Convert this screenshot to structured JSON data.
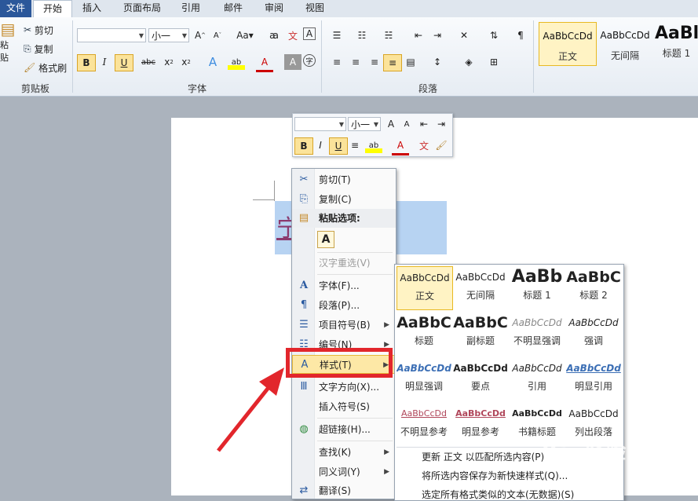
{
  "ribbon": {
    "tabs": [
      "文件",
      "开始",
      "插入",
      "页面布局",
      "引用",
      "邮件",
      "审阅",
      "视图"
    ],
    "clipboard": {
      "paste": "粘贴",
      "cut": "剪切",
      "copy": "复制",
      "format_painter": "格式刷",
      "group": "剪贴板"
    },
    "font": {
      "font_name": "",
      "font_size": "小一",
      "group": "字体"
    },
    "paragraph": {
      "group": "段落"
    },
    "styles": [
      {
        "preview": "AaBbCcDd",
        "name": "正文"
      },
      {
        "preview": "AaBbCcDd",
        "name": "无间隔"
      },
      {
        "preview": "AaBl",
        "name": "标题 1"
      }
    ]
  },
  "document": {
    "selected_text": "宁313"
  },
  "mini_toolbar": {
    "font_size": "小一"
  },
  "context_menu": {
    "items": [
      {
        "label": "剪切(T)",
        "icon": "scissors-icon"
      },
      {
        "label": "复制(C)",
        "icon": "copy-icon"
      },
      {
        "label": "粘贴选项:",
        "icon": "paste-icon"
      },
      {
        "label": "A"
      },
      {
        "label": "汉字重选(V)"
      },
      {
        "label": "字体(F)...",
        "icon": "font-icon"
      },
      {
        "label": "段落(P)...",
        "icon": "paragraph-icon"
      },
      {
        "label": "项目符号(B)",
        "icon": "bullets-icon"
      },
      {
        "label": "编号(N)",
        "icon": "numbering-icon"
      },
      {
        "label": "样式(T)",
        "icon": "styles-icon"
      },
      {
        "label": "文字方向(X)...",
        "icon": "text-direction-icon"
      },
      {
        "label": "插入符号(S)"
      },
      {
        "label": "超链接(H)...",
        "icon": "hyperlink-icon"
      },
      {
        "label": "查找(K)"
      },
      {
        "label": "同义词(Y)"
      },
      {
        "label": "翻译(S)",
        "icon": "translate-icon"
      }
    ]
  },
  "styles_gallery": {
    "items": [
      {
        "preview": "AaBbCcDd",
        "name": "正文"
      },
      {
        "preview": "AaBbCcDd",
        "name": "无间隔"
      },
      {
        "preview": "AaBb",
        "name": "标题 1"
      },
      {
        "preview": "AaBbC",
        "name": "标题 2"
      },
      {
        "preview": "AaBbC",
        "name": "标题"
      },
      {
        "preview": "AaBbC",
        "name": "副标题"
      },
      {
        "preview": "AaBbCcDd",
        "name": "不明显强调"
      },
      {
        "preview": "AaBbCcDd",
        "name": "强调"
      },
      {
        "preview": "AaBbCcDd",
        "name": "明显强调"
      },
      {
        "preview": "AaBbCcDd",
        "name": "要点"
      },
      {
        "preview": "AaBbCcDd",
        "name": "引用"
      },
      {
        "preview": "AaBbCcDd",
        "name": "明显引用"
      },
      {
        "preview": "AaBbCcDd",
        "name": "不明显参考"
      },
      {
        "preview": "AaBbCcDd",
        "name": "明显参考"
      },
      {
        "preview": "AaBbCcDd",
        "name": "书籍标题"
      },
      {
        "preview": "AaBbCcDd",
        "name": "列出段落"
      }
    ],
    "actions": [
      "更新 正文 以匹配所选内容(P)",
      "将所选内容保存为新快速样式(Q)...",
      "选定所有格式类似的文本(无数据)(S)"
    ]
  },
  "watermark": "Bai 经验"
}
